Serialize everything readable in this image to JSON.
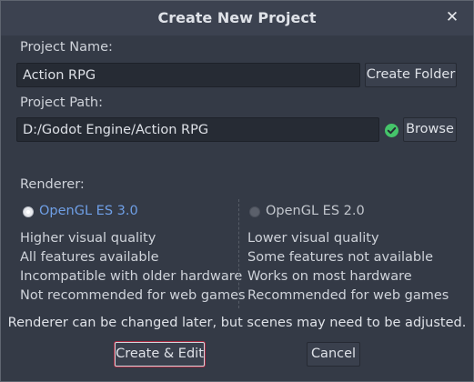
{
  "dialog": {
    "title": "Create New Project",
    "close_label": "✕"
  },
  "project_name": {
    "label": "Project Name:",
    "value": "Action RPG",
    "create_folder_label": "Create Folder"
  },
  "project_path": {
    "label": "Project Path:",
    "value": "D:/Godot Engine/Action RPG",
    "browse_label": "Browse",
    "status_icon": "checkmark-circle-icon",
    "status_color": "#45c46a"
  },
  "renderer": {
    "label": "Renderer:",
    "options": [
      {
        "label": "OpenGL ES 3.0",
        "selected": true,
        "features": [
          "Higher visual quality",
          "All features available",
          "Incompatible with older hardware",
          "Not recommended for web games"
        ]
      },
      {
        "label": "OpenGL ES 2.0",
        "selected": false,
        "features": [
          "Lower visual quality",
          "Some features not available",
          "Works on most hardware",
          "Recommended for web games"
        ]
      }
    ],
    "note": "Renderer can be changed later, but scenes may need to be adjusted."
  },
  "buttons": {
    "create_edit": "Create & Edit",
    "cancel": "Cancel"
  },
  "colors": {
    "accent": "#6f9fe6",
    "focus_ring": "#a82840",
    "dialog_bg": "#343a46"
  }
}
